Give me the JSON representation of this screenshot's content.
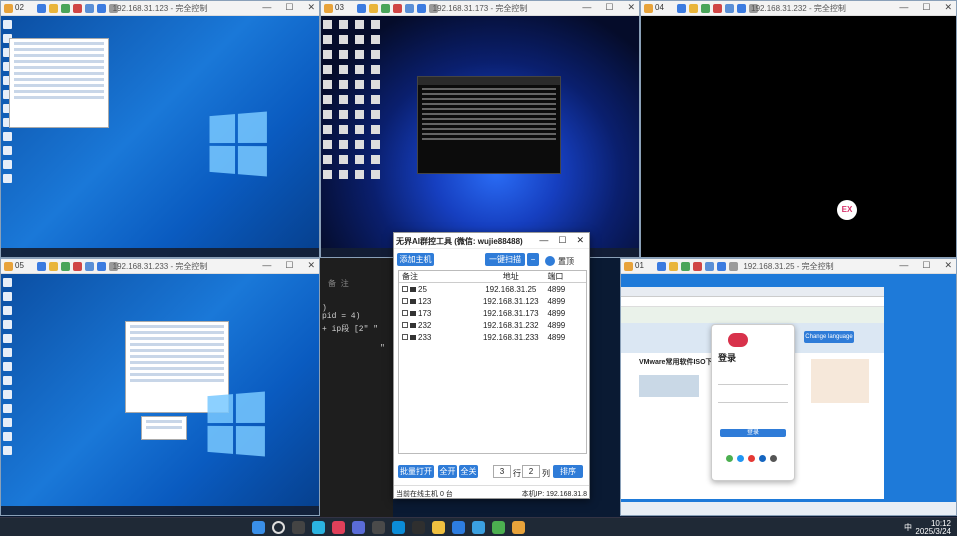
{
  "windows": [
    {
      "num": "02",
      "title": "192.168.31.123 - 完全控制"
    },
    {
      "num": "03",
      "title": "192.168.31.173 - 完全控制"
    },
    {
      "num": "04",
      "title": "192.168.31.232 - 完全控制"
    },
    {
      "num": "05",
      "title": "192.168.31.233 - 完全控制"
    },
    {
      "num": "01",
      "title": "192.168.31.25 - 完全控制"
    }
  ],
  "window_controls": {
    "min": "—",
    "max": "☐",
    "close": "✕"
  },
  "tool": {
    "title": "无界AI群控工具 (微信: wujie88488)",
    "add_host": "添加主机",
    "scan": "一键扫描",
    "minus": "−",
    "pin": "置顶",
    "headers": {
      "remark": "备注",
      "address": "地址",
      "port": "端口"
    },
    "rows": [
      {
        "remark": "25",
        "address": "192.168.31.25",
        "port": "4899"
      },
      {
        "remark": "123",
        "address": "192.168.31.123",
        "port": "4899"
      },
      {
        "remark": "173",
        "address": "192.168.31.173",
        "port": "4899"
      },
      {
        "remark": "232",
        "address": "192.168.31.232",
        "port": "4899"
      },
      {
        "remark": "233",
        "address": "192.168.31.233",
        "port": "4899"
      }
    ],
    "batch_open": "批量打开",
    "open_all": "全开",
    "close_all": "全关",
    "rows_value": "3",
    "rows_label": "行",
    "cols_value": "2",
    "cols_label": "列",
    "sort": "排序",
    "status_left": "当前在线主机 0 台",
    "status_right": "本机IP: 192.168.31.8"
  },
  "code_fragments": {
    "line1": "备 注",
    "line2": ")",
    "line3": "  pid = 4)",
    "line4": "+ ip段 [2\" \"",
    "line5": "\""
  },
  "browser": {
    "login_title": "登录",
    "login_btn": "登录",
    "change_lang": "Change language",
    "article_title": "VMware常用软件ISO下载汇..."
  },
  "remote_icons": {
    "ex_logo": "EX"
  },
  "taskbar": {
    "time": "10:12",
    "date": "2025/3/24",
    "ime": "中"
  }
}
